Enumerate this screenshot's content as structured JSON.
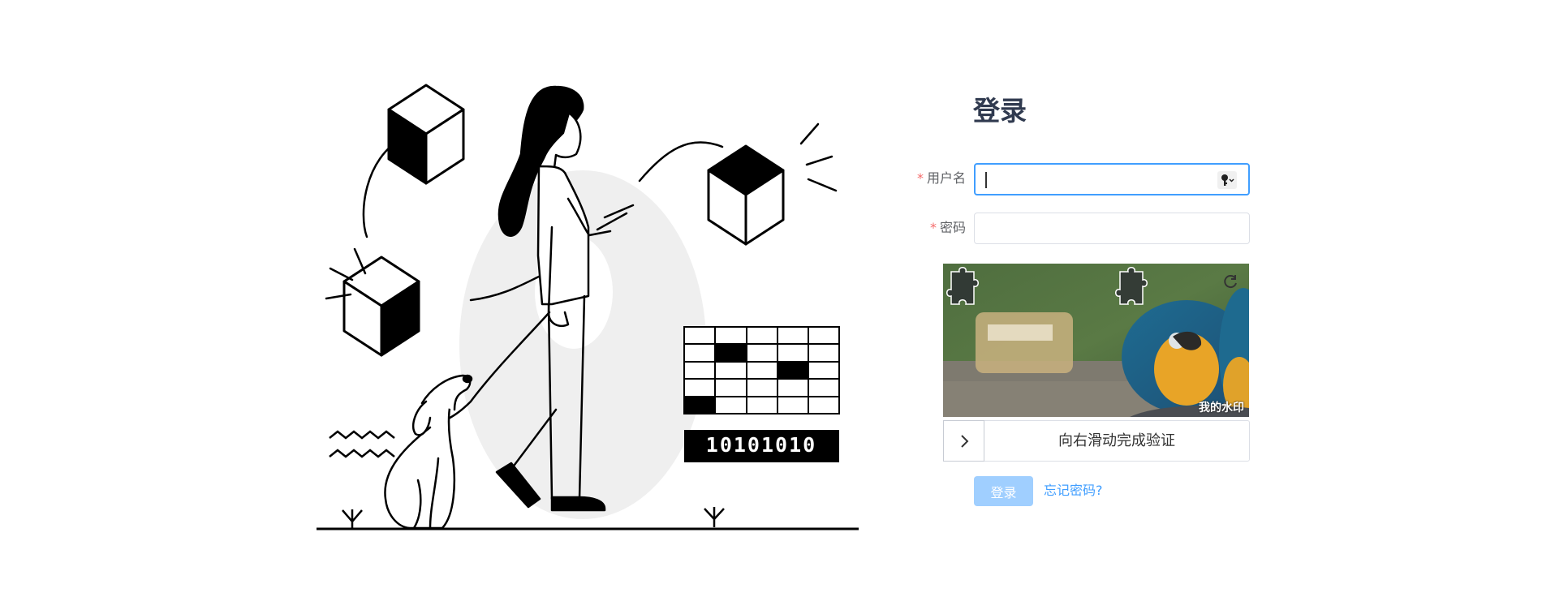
{
  "login": {
    "title": "登录",
    "username_label": "用户名",
    "password_label": "密码",
    "required_mark": "*",
    "username_value": "",
    "password_value": "",
    "captcha_watermark": "我的水印",
    "slider_text": "向右滑动完成验证",
    "login_button": "登录",
    "forgot_link": "忘记密码?"
  },
  "illustration": {
    "binary_text": "10101010"
  },
  "colors": {
    "primary": "#409eff",
    "disabled_button": "#a0cfff",
    "title": "#303a4f",
    "required": "#f56c6c"
  },
  "icons": [
    "key-icon",
    "refresh-icon",
    "chevron-right-icon",
    "puzzle-piece-icon"
  ]
}
